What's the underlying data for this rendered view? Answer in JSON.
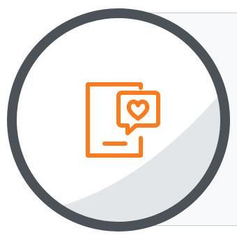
{
  "badge": {
    "icon": "phone-heart-message-icon",
    "colors": {
      "ring": "#4b5359",
      "disc": "#ffffff",
      "shade": "#e3e6e8",
      "accent": "#ff7a1a",
      "card_border": "#c9cccf",
      "card_fill": "#f8f9fa"
    }
  }
}
